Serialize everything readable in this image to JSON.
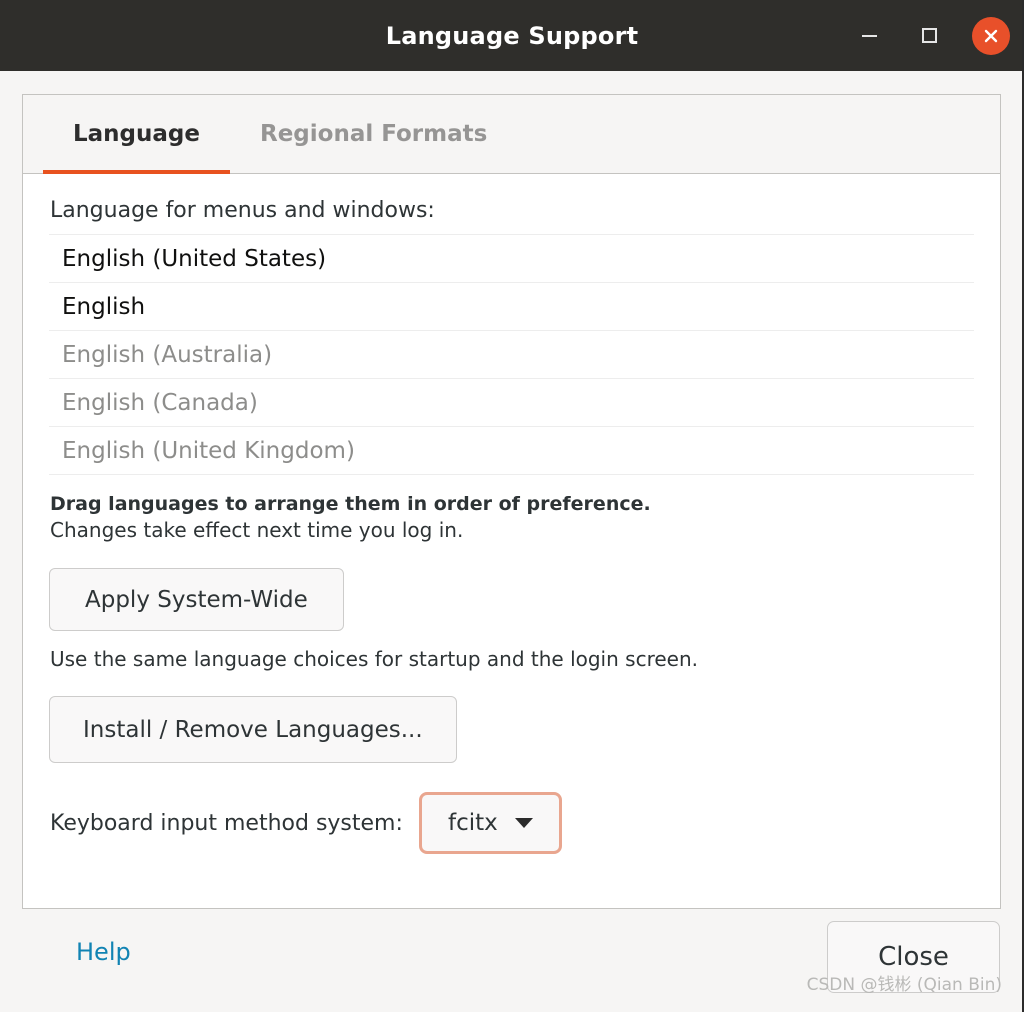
{
  "window": {
    "title": "Language Support",
    "controls": {
      "minimize": "minimize-icon",
      "maximize": "maximize-icon",
      "close": "close-icon"
    },
    "close_button_color": "#e8502a",
    "titlebar_color": "#2f2e2b"
  },
  "tabs": [
    {
      "label": "Language",
      "active": true
    },
    {
      "label": "Regional Formats",
      "active": false
    }
  ],
  "accent_color": "#e8521f",
  "main": {
    "list_label": "Language for menus and windows:",
    "languages": [
      {
        "name": "English (United States)",
        "enabled": true
      },
      {
        "name": "English",
        "enabled": true
      },
      {
        "name": "English (Australia)",
        "enabled": false
      },
      {
        "name": "English (Canada)",
        "enabled": false
      },
      {
        "name": "English (United Kingdom)",
        "enabled": false
      }
    ],
    "hint_bold": "Drag languages to arrange them in order of preference.",
    "hint_normal": "Changes take effect next time you log in.",
    "apply_button": "Apply System-Wide",
    "apply_caption": "Use the same language choices for startup and the login screen.",
    "install_button": "Install / Remove Languages...",
    "input_method_label": "Keyboard input method system:",
    "input_method_value": "fcitx",
    "input_method_focus_color": "#e9a68f"
  },
  "footer": {
    "help_label": "Help",
    "help_color": "#1183b3",
    "close_label": "Close"
  },
  "watermark": "CSDN @钱彬 (Qian Bin)"
}
